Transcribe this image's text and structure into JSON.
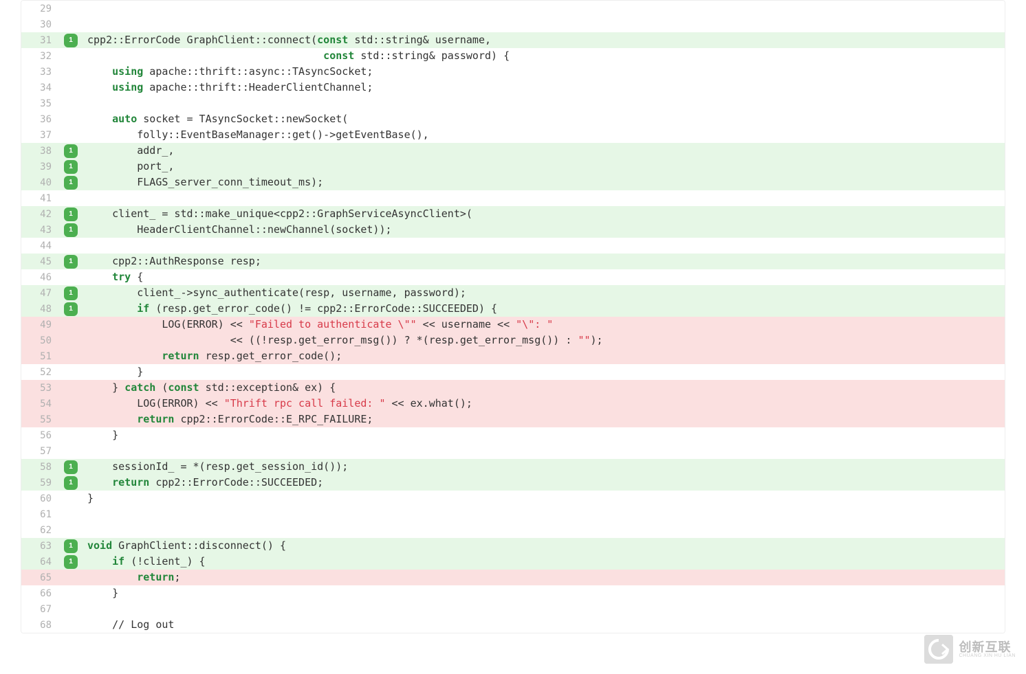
{
  "logo": {
    "cn": "创新互联",
    "en": "CHUANG XIN HU LIAN"
  },
  "badge": "1",
  "lines": [
    {
      "n": 29,
      "bg": "white",
      "badge": false,
      "segs": []
    },
    {
      "n": 30,
      "bg": "white",
      "badge": false,
      "segs": []
    },
    {
      "n": 31,
      "bg": "green",
      "badge": true,
      "segs": [
        {
          "t": "cpp2::ErrorCode GraphClient::connect("
        },
        {
          "t": "const",
          "c": "kw"
        },
        {
          "t": " std::string& username,"
        }
      ]
    },
    {
      "n": 32,
      "bg": "white",
      "badge": false,
      "segs": [
        {
          "t": "                                      "
        },
        {
          "t": "const",
          "c": "kw"
        },
        {
          "t": " std::string& password) {"
        }
      ]
    },
    {
      "n": 33,
      "bg": "white",
      "badge": false,
      "segs": [
        {
          "t": "    "
        },
        {
          "t": "using",
          "c": "kw"
        },
        {
          "t": " apache::thrift::async::TAsyncSocket;"
        }
      ]
    },
    {
      "n": 34,
      "bg": "white",
      "badge": false,
      "segs": [
        {
          "t": "    "
        },
        {
          "t": "using",
          "c": "kw"
        },
        {
          "t": " apache::thrift::HeaderClientChannel;"
        }
      ]
    },
    {
      "n": 35,
      "bg": "white",
      "badge": false,
      "segs": []
    },
    {
      "n": 36,
      "bg": "white",
      "badge": false,
      "segs": [
        {
          "t": "    "
        },
        {
          "t": "auto",
          "c": "kw"
        },
        {
          "t": " socket = TAsyncSocket::newSocket("
        }
      ]
    },
    {
      "n": 37,
      "bg": "white",
      "badge": false,
      "segs": [
        {
          "t": "        folly::EventBaseManager::get()->getEventBase(),"
        }
      ]
    },
    {
      "n": 38,
      "bg": "green",
      "badge": true,
      "segs": [
        {
          "t": "        addr_,"
        }
      ]
    },
    {
      "n": 39,
      "bg": "green",
      "badge": true,
      "segs": [
        {
          "t": "        port_,"
        }
      ]
    },
    {
      "n": 40,
      "bg": "green",
      "badge": true,
      "segs": [
        {
          "t": "        FLAGS_server_conn_timeout_ms);"
        }
      ]
    },
    {
      "n": 41,
      "bg": "white",
      "badge": false,
      "segs": []
    },
    {
      "n": 42,
      "bg": "green",
      "badge": true,
      "segs": [
        {
          "t": "    client_ = std::make_unique<cpp2::GraphServiceAsyncClient>("
        }
      ]
    },
    {
      "n": 43,
      "bg": "green",
      "badge": true,
      "segs": [
        {
          "t": "        HeaderClientChannel::newChannel(socket));"
        }
      ]
    },
    {
      "n": 44,
      "bg": "white",
      "badge": false,
      "segs": []
    },
    {
      "n": 45,
      "bg": "green",
      "badge": true,
      "segs": [
        {
          "t": "    cpp2::AuthResponse resp;"
        }
      ]
    },
    {
      "n": 46,
      "bg": "white",
      "badge": false,
      "segs": [
        {
          "t": "    "
        },
        {
          "t": "try",
          "c": "kw"
        },
        {
          "t": " {"
        }
      ]
    },
    {
      "n": 47,
      "bg": "green",
      "badge": true,
      "segs": [
        {
          "t": "        client_->sync_authenticate(resp, username, password);"
        }
      ]
    },
    {
      "n": 48,
      "bg": "green",
      "badge": true,
      "segs": [
        {
          "t": "        "
        },
        {
          "t": "if",
          "c": "kw"
        },
        {
          "t": " (resp.get_error_code() != cpp2::ErrorCode::SUCCEEDED) {"
        }
      ]
    },
    {
      "n": 49,
      "bg": "red",
      "badge": false,
      "segs": [
        {
          "t": "            LOG(ERROR) << "
        },
        {
          "t": "\"Failed to authenticate \\\"\"",
          "c": "str"
        },
        {
          "t": " << username << "
        },
        {
          "t": "\"\\\": \"",
          "c": "str"
        }
      ]
    },
    {
      "n": 50,
      "bg": "red",
      "badge": false,
      "segs": [
        {
          "t": "                       << ((!resp.get_error_msg()) ? *(resp.get_error_msg()) : "
        },
        {
          "t": "\"\"",
          "c": "str"
        },
        {
          "t": ");"
        }
      ]
    },
    {
      "n": 51,
      "bg": "red",
      "badge": false,
      "segs": [
        {
          "t": "            "
        },
        {
          "t": "return",
          "c": "kw"
        },
        {
          "t": " resp.get_error_code();"
        }
      ]
    },
    {
      "n": 52,
      "bg": "white",
      "badge": false,
      "segs": [
        {
          "t": "        }"
        }
      ]
    },
    {
      "n": 53,
      "bg": "red",
      "badge": false,
      "segs": [
        {
          "t": "    } "
        },
        {
          "t": "catch",
          "c": "kw"
        },
        {
          "t": " ("
        },
        {
          "t": "const",
          "c": "kw"
        },
        {
          "t": " std::exception& ex) {"
        }
      ]
    },
    {
      "n": 54,
      "bg": "red",
      "badge": false,
      "segs": [
        {
          "t": "        LOG(ERROR) << "
        },
        {
          "t": "\"Thrift rpc call failed: \"",
          "c": "str"
        },
        {
          "t": " << ex.what();"
        }
      ]
    },
    {
      "n": 55,
      "bg": "red",
      "badge": false,
      "segs": [
        {
          "t": "        "
        },
        {
          "t": "return",
          "c": "kw"
        },
        {
          "t": " cpp2::ErrorCode::E_RPC_FAILURE;"
        }
      ]
    },
    {
      "n": 56,
      "bg": "white",
      "badge": false,
      "segs": [
        {
          "t": "    }"
        }
      ]
    },
    {
      "n": 57,
      "bg": "white",
      "badge": false,
      "segs": []
    },
    {
      "n": 58,
      "bg": "green",
      "badge": true,
      "segs": [
        {
          "t": "    sessionId_ = *(resp.get_session_id());"
        }
      ]
    },
    {
      "n": 59,
      "bg": "green",
      "badge": true,
      "segs": [
        {
          "t": "    "
        },
        {
          "t": "return",
          "c": "kw"
        },
        {
          "t": " cpp2::ErrorCode::SUCCEEDED;"
        }
      ]
    },
    {
      "n": 60,
      "bg": "white",
      "badge": false,
      "segs": [
        {
          "t": "}"
        }
      ]
    },
    {
      "n": 61,
      "bg": "white",
      "badge": false,
      "segs": []
    },
    {
      "n": 62,
      "bg": "white",
      "badge": false,
      "segs": []
    },
    {
      "n": 63,
      "bg": "green",
      "badge": true,
      "segs": [
        {
          "t": "void",
          "c": "kw"
        },
        {
          "t": " GraphClient::disconnect() {"
        }
      ]
    },
    {
      "n": 64,
      "bg": "green",
      "badge": true,
      "segs": [
        {
          "t": "    "
        },
        {
          "t": "if",
          "c": "kw"
        },
        {
          "t": " (!client_) {"
        }
      ]
    },
    {
      "n": 65,
      "bg": "red",
      "badge": false,
      "segs": [
        {
          "t": "        "
        },
        {
          "t": "return",
          "c": "kw"
        },
        {
          "t": ";"
        }
      ]
    },
    {
      "n": 66,
      "bg": "white",
      "badge": false,
      "segs": [
        {
          "t": "    }"
        }
      ]
    },
    {
      "n": 67,
      "bg": "white",
      "badge": false,
      "segs": []
    },
    {
      "n": 68,
      "bg": "white",
      "badge": false,
      "segs": [
        {
          "t": "    // Log out",
          "c": "comment"
        }
      ]
    }
  ]
}
